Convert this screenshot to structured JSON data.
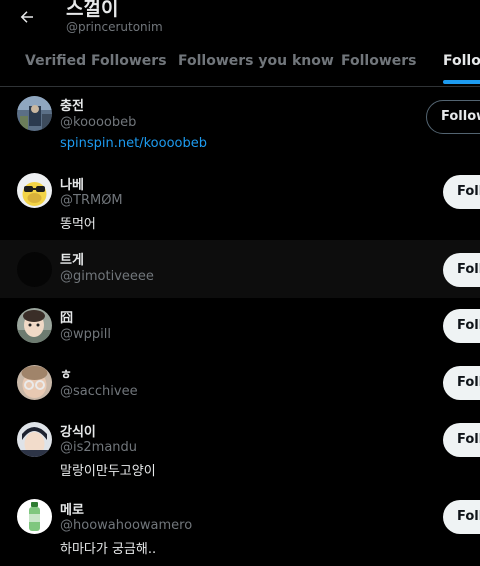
{
  "header": {
    "title": "스껄이",
    "subtitle": "@princerutonim"
  },
  "tabs": [
    {
      "label": "Verified Followers"
    },
    {
      "label": "Followers you know"
    },
    {
      "label": "Followers"
    },
    {
      "label": "Following"
    }
  ],
  "active_tab": "Following",
  "colors": {
    "background": "#000000",
    "accent": "#1d9bf0",
    "muted_text": "#71767b"
  },
  "users": [
    {
      "name": "충전",
      "handle": "@koooobeb",
      "bio": "spinspin.net/koooobeb",
      "button": "Following"
    },
    {
      "name": "나베",
      "handle": "@TRMØM",
      "bio": "똥먹어",
      "button": "Follow"
    },
    {
      "name": "트게",
      "handle": "@gimotiveeee",
      "bio": "",
      "button": "Follow"
    },
    {
      "name": "囧",
      "handle": "@wppill",
      "bio": "",
      "button": "Follow"
    },
    {
      "name": "ㅎ",
      "handle": "@sacchivee",
      "bio": "",
      "button": "Follow"
    },
    {
      "name": "강식이",
      "handle": "@is2mandu",
      "bio": "말랑이만두고양이",
      "button": "Follow"
    },
    {
      "name": "메로",
      "handle": "@hoowahoowamero",
      "bio": "하마다가 궁금해..",
      "button": "Follow"
    }
  ]
}
